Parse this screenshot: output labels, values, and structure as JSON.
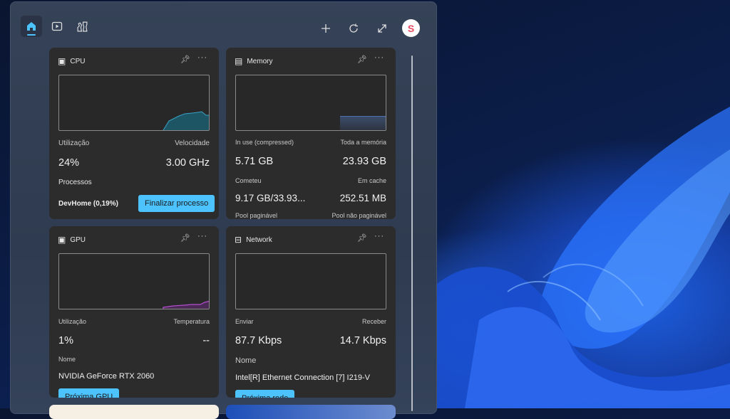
{
  "toolbar": {
    "tabs": [
      {
        "icon": "home-icon",
        "active": true
      },
      {
        "icon": "play-icon"
      },
      {
        "icon": "chess-icon"
      }
    ],
    "actions": [
      {
        "icon": "plus-icon"
      },
      {
        "icon": "refresh-icon"
      },
      {
        "icon": "expand-icon"
      }
    ],
    "avatar_letter": "S"
  },
  "accent": "#4cc2ff",
  "cpu": {
    "title": "CPU",
    "util_label": "Utilização",
    "util": "24%",
    "speed_label": "Velocidade",
    "speed": "3.00 GHz",
    "proc_label": "Processos",
    "proc": "DevHome (0,19%)",
    "button": "Finalizar processo",
    "graph": [
      0,
      0,
      0,
      0,
      0,
      0,
      0,
      0,
      0,
      0,
      0,
      0,
      0,
      0,
      0,
      0,
      0,
      0,
      0,
      0,
      0,
      0,
      0,
      0,
      0,
      0,
      0,
      0,
      0,
      0,
      0,
      0,
      0,
      0,
      0,
      0,
      0,
      0,
      0,
      0,
      0,
      0,
      0,
      0,
      0,
      0,
      0,
      0,
      0,
      0,
      0,
      0,
      0,
      0,
      0,
      0,
      0,
      0,
      0,
      0,
      0,
      0,
      0,
      0,
      0,
      0,
      0,
      0,
      0,
      0,
      0,
      0,
      0,
      0,
      0,
      0,
      0,
      0,
      0,
      0,
      0,
      0,
      0,
      0,
      0,
      0,
      0,
      0,
      0,
      0,
      0,
      0,
      0,
      0,
      0,
      0,
      0,
      0,
      0,
      0,
      0,
      0,
      0,
      0,
      0,
      0,
      0,
      0,
      0,
      0,
      0,
      0,
      0,
      0,
      0,
      0,
      0,
      0,
      0,
      0,
      0,
      0,
      0,
      0,
      0,
      0,
      0,
      0,
      0,
      0,
      0,
      0,
      0,
      0,
      0,
      0,
      0,
      0,
      0,
      0,
      0,
      0,
      0,
      0,
      0,
      0,
      0,
      0,
      0,
      0,
      0,
      0,
      0,
      0,
      0,
      0,
      0,
      0,
      0,
      0,
      0,
      0,
      0,
      0,
      0,
      0,
      0,
      0,
      0,
      0,
      0,
      0,
      0,
      0,
      0,
      0,
      0,
      0,
      0,
      0,
      0,
      0,
      0,
      0,
      0,
      0,
      0,
      0,
      0,
      0,
      0,
      0,
      0,
      0,
      0,
      0,
      0,
      0,
      0,
      0,
      0,
      0,
      0,
      0,
      0,
      0,
      0,
      0,
      0,
      0,
      0,
      0,
      0,
      0,
      0,
      0,
      0,
      0,
      0,
      0
    ]
  },
  "memory": {
    "title": "Memory",
    "inuse_label": "In use (compressed)",
    "inuse": "5.71 GB",
    "total_label": "Toda a memória",
    "total": "23.93 GB",
    "committed_label": "Cometeu",
    "committed": "9.17 GB/33.93...",
    "cached_label": "Em cache",
    "cached": "252.51 MB",
    "paged_label": "Pool paginável",
    "nonpaged_label": "Pool não paginável"
  },
  "gpu": {
    "title": "GPU",
    "util_label": "Utilização",
    "util": "1%",
    "temp_label": "Temperatura",
    "temp": "--",
    "name_label": "Nome",
    "name": "NVIDIA GeForce RTX 2060",
    "button": "Próxima GPU"
  },
  "network": {
    "title": "Network",
    "send_label": "Enviar",
    "send": "87.7 Kbps",
    "recv_label": "Receber",
    "recv": "14.7 Kbps",
    "name_label": "Nome",
    "name": "Intel[R] Ethernet Connection [7] I219-V",
    "button": "Próxima rede"
  }
}
